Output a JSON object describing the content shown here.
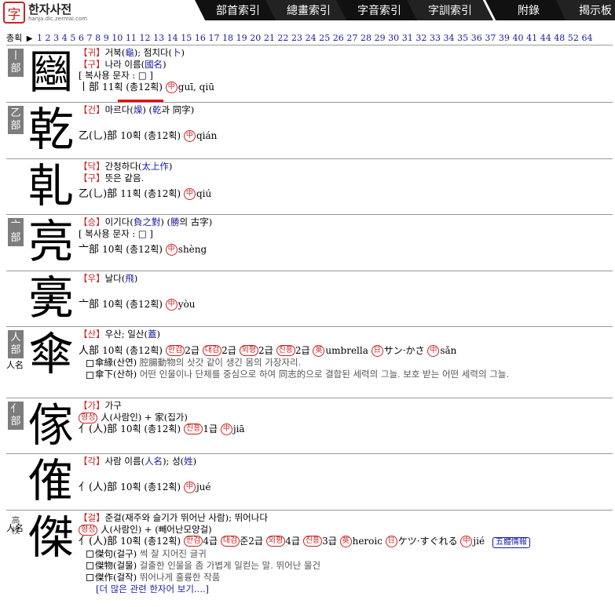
{
  "site": {
    "seal": "字",
    "title": "한자사전",
    "subtitle": "hanja.dic.zermai.com"
  },
  "tabs": [
    "部首索引",
    "總畫索引",
    "字音索引",
    "字訓索引",
    "附錄",
    "揭示板"
  ],
  "index": {
    "label": "총획",
    "numbers": [
      "1",
      "2",
      "3",
      "4",
      "5",
      "6",
      "7",
      "8",
      "9",
      "10",
      "11",
      "12",
      "13",
      "14",
      "15",
      "16",
      "17",
      "18",
      "19",
      "20",
      "21",
      "22",
      "23",
      "24",
      "25",
      "26",
      "27",
      "28",
      "29",
      "30",
      "31",
      "32",
      "33",
      "34",
      "35",
      "36",
      "37",
      "39",
      "40",
      "41",
      "44",
      "48",
      "52",
      "64"
    ]
  },
  "entries": [
    {
      "rad_tag": "丨部",
      "char": "圝",
      "lines": [
        {
          "s": "【귀】",
          "t": "거북(",
          "l": "龜",
          "t2": "); 점치다(",
          "l2": "卜",
          "t3": ")"
        },
        {
          "s": "【구】",
          "t": "나라 이름(",
          "l": "國名",
          "t2": ")",
          "l2": "",
          "t3": ""
        },
        {
          "s": "",
          "t": "[ 복사용 문자 : □ ]",
          "l": "",
          "t2": "",
          "l2": "",
          "t3": ""
        }
      ],
      "meta": {
        "rad": "丨部",
        "strokes": "11획 (총12획)",
        "cn": "中",
        "pin": "guī, qiū"
      }
    },
    {
      "rad_tag": "乙部",
      "char": "乾",
      "lines": [
        {
          "s": "【건】",
          "t": "마르다(",
          "l": "燥",
          "t2": ") (",
          "l2": "乾",
          "t3": "과 同字)"
        }
      ],
      "meta": {
        "rad": "乙(乚)部",
        "strokes": "10획 (총12획)",
        "cn": "中",
        "pin": "qián"
      }
    },
    {
      "rad_tag": "",
      "char": "乹",
      "lines": [
        {
          "s": "【닥】",
          "t": "간청하다(",
          "l": "太上作",
          "t2": ")",
          "l2": "",
          "t3": ""
        },
        {
          "s": "【구】",
          "t": "뜻은 같음.",
          "l": "",
          "t2": "",
          "l2": "",
          "t3": ""
        }
      ],
      "meta": {
        "rad": "乙(乚)部",
        "strokes": "11획 (총12획)",
        "cn": "中",
        "pin": "qiú"
      }
    },
    {
      "rad_tag": "亠部",
      "char": "亮",
      "lines": [
        {
          "s": "【승】",
          "t": "이기다(",
          "l": "負之對",
          "t2": ") (",
          "l2": "勝",
          "t3": "의 古字)"
        },
        {
          "s": "",
          "t": "[ 복사용 문자 : □ ]",
          "l": "",
          "t2": "",
          "l2": "",
          "t3": ""
        }
      ],
      "meta": {
        "rad": "亠部",
        "strokes": "10획 (총12획)",
        "cn": "中",
        "pin": "shèng"
      }
    },
    {
      "rad_tag": "",
      "char": "亴",
      "lines": [
        {
          "s": "【우】",
          "t": "날다(",
          "l": "飛",
          "t2": ")",
          "l2": "",
          "t3": ""
        }
      ],
      "meta": {
        "rad": "亠部",
        "strokes": "10획 (총12획)",
        "cn": "中",
        "pin": "yòu"
      }
    },
    {
      "rad_tag": "人部",
      "tag2": "人名",
      "char": "傘",
      "lines": [
        {
          "s": "【산】",
          "t": "우산; 일산(",
          "l": "蓋",
          "t2": ")",
          "l2": "",
          "t3": ""
        }
      ],
      "meta": {
        "rad": "人部",
        "strokes": "10획 (총12획)",
        "grades": [
          "한검",
          "2급",
          "대검",
          "2급",
          "외평",
          "2급",
          "진흥",
          "2급"
        ],
        "en": "英",
        "enw": "umbrella",
        "jp": "日",
        "jpw": "サン·かさ",
        "cn": "中",
        "pin": "sǎn"
      },
      "words": [
        {
          "w": "傘緣(산연)",
          "g": " 腔腸動物의 삿갓 같이 생긴 몸의 가장자리."
        },
        {
          "w": "傘下(산하)",
          "g": " 어떤 인물이나 단체를 중심으로 하여 同志的으로 결합된 세력의 그늘. 보호 받는 어떤 세력의 그늘."
        }
      ]
    },
    {
      "rad_tag": "亻部",
      "char": "傢",
      "lines": [
        {
          "s": "【가】",
          "t": "가구",
          "l": "",
          "t2": "",
          "l2": "",
          "t3": ""
        }
      ],
      "form": {
        "label": "형성",
        "text": "人(사람인) + 家(집가)"
      },
      "meta": {
        "rad": "亻(人)部",
        "strokes": "10획 (총12획)",
        "grades": [
          "진흥",
          "1급"
        ],
        "cn": "中",
        "pin": "jiā"
      }
    },
    {
      "rad_tag": "",
      "char": "傕",
      "lines": [
        {
          "s": "【각】",
          "t": "사람 이름(",
          "l": "人名",
          "t2": "); 성(",
          "l2": "姓",
          "t3": ")"
        }
      ],
      "meta": {
        "rad": "亻(人)部",
        "strokes": "10획 (총12획)",
        "cn": "中",
        "pin": "jué"
      }
    },
    {
      "rad_tag": "高校",
      "tag2": "人名",
      "char": "傑",
      "lines": [
        {
          "s": "【걸】",
          "t": "준걸(재주와 슬기가 뛰어난 사람); 뛰어나다",
          "l": "",
          "t2": "",
          "l2": "",
          "t3": ""
        }
      ],
      "form": {
        "label": "형성",
        "text": "人(사람인) + (빼어난모양걸)"
      },
      "meta": {
        "rad": "亻(人)部",
        "strokes": "10획 (총12획)",
        "grades": [
          "한검",
          "4급",
          "대검",
          "준2급",
          "외평",
          "4급",
          "진흥",
          "3급"
        ],
        "en": "英",
        "enw": "heroic",
        "jp": "日",
        "jpw": "ケツ·すぐれる",
        "cn": "中",
        "pin": "jié",
        "extra": "五體情報"
      },
      "words": [
        {
          "w": "傑句(걸구)",
          "g": " 썩 잘 지어진 글귀"
        },
        {
          "w": "傑物(걸물)",
          "g": " 걸출한 인물을 좀 가볍게 일컫는 말. 뛰어난 물건"
        },
        {
          "w": "傑作(걸작)",
          "g": " 뛰어나게 훌륭한 작품"
        }
      ],
      "more": "[더 많은 관련 한자어 보기....]"
    }
  ]
}
